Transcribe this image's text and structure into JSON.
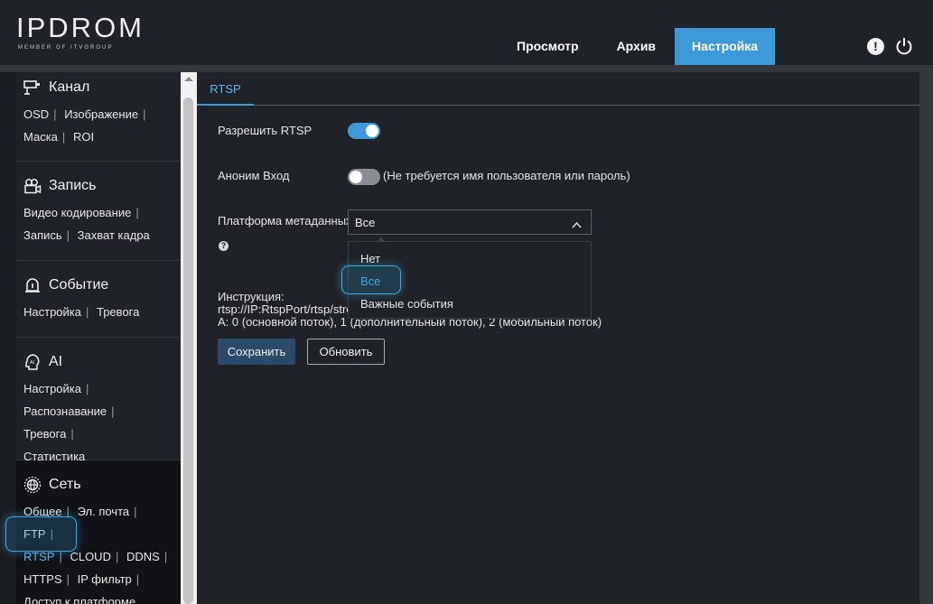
{
  "brand": {
    "name": "IPDROM",
    "tagline": "MEMBER OF ITVGROUP"
  },
  "nav": [
    {
      "label": "Просмотр",
      "active": false
    },
    {
      "label": "Архив",
      "active": false
    },
    {
      "label": "Настройка",
      "active": true
    }
  ],
  "header_icons": {
    "info": "!",
    "info_icon": "alert-icon",
    "power_icon": "power-icon"
  },
  "sidebar": {
    "channel": {
      "title": "Канал",
      "icon": "camera-icon",
      "links": [
        "OSD",
        "Изображение",
        "Маска",
        "ROI"
      ]
    },
    "record": {
      "title": "Запись",
      "icon": "video-camera-icon",
      "links": [
        "Видео кодирование",
        "Запись",
        "Захват кадра"
      ]
    },
    "event": {
      "title": "Событие",
      "icon": "alarm-icon",
      "links": [
        "Настройка",
        "Тревога"
      ]
    },
    "ai": {
      "title": "AI",
      "icon": "ai-head-icon",
      "links": [
        "Настройка",
        "Распознавание",
        "Тревога",
        "Статистика"
      ]
    },
    "network": {
      "title": "Сеть",
      "icon": "globe-icon",
      "links": [
        "Общее",
        "Эл. почта",
        "FTP",
        "RTSP",
        "CLOUD",
        "DDNS",
        "HTTPS",
        "IP фильтр",
        "Доступ к платформе"
      ],
      "active": "RTSP"
    }
  },
  "main": {
    "tab": "RTSP",
    "enable_rtsp": {
      "label": "Разрешить RTSP",
      "value": true
    },
    "anonymous": {
      "label": "Аноним Вход",
      "value": false,
      "hint": "(Не требуется имя пользователя или пароль)"
    },
    "metadata": {
      "label": "Платформа метаданных",
      "value": "Все",
      "help": "?",
      "options": [
        "Нет",
        "Все",
        "Важные события"
      ],
      "selected": "Все"
    },
    "instruction": {
      "line1": "Инструкция:",
      "line2": "rtsp://IP:RtspPort/rtsp/stre",
      "line3": "A: 0 (основной поток), 1 (дополнительный поток), 2 (мобильный поток)"
    },
    "save_label": "Сохранить",
    "refresh_label": "Обновить"
  },
  "colors": {
    "accent": "#3d9ad8",
    "link_active": "#5fb4ea",
    "background": "#1f2226",
    "save_button": "#2a4a69"
  }
}
